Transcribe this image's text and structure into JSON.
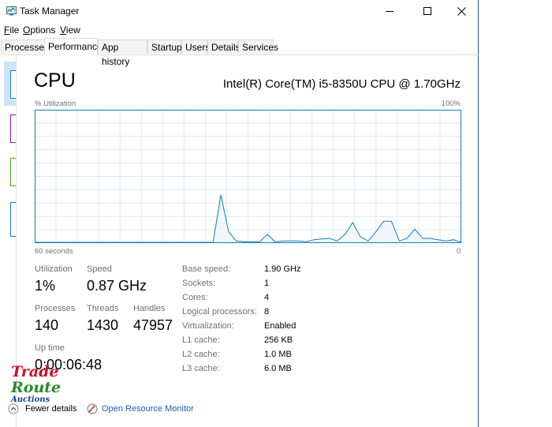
{
  "window": {
    "title": "Task Manager"
  },
  "menu": [
    {
      "label": "File",
      "key": "F",
      "rest": "ile"
    },
    {
      "label": "Options",
      "key": "O",
      "rest": "ptions"
    },
    {
      "label": "View",
      "key": "V",
      "rest": "iew"
    }
  ],
  "tabs": [
    "Processes",
    "Performance",
    "App history",
    "Startup",
    "Users",
    "Details",
    "Services"
  ],
  "active_tab": "Performance",
  "cpu": {
    "title": "CPU",
    "model": "Intel(R) Core(TM) i5-8350U CPU @ 1.70GHz",
    "graph_label": "% Utilization",
    "graph_max": "100%",
    "time_left": "60 seconds",
    "time_right": "0"
  },
  "chart_data": {
    "type": "area",
    "x": [
      60,
      59,
      58,
      57,
      56,
      55,
      54,
      53,
      52,
      51,
      50,
      49,
      48,
      47,
      46,
      45,
      44,
      43,
      42,
      41,
      40,
      39,
      38,
      37,
      36,
      35,
      34,
      33,
      32,
      31,
      30,
      29,
      28,
      27,
      26,
      25,
      24,
      23,
      22,
      21,
      20,
      19,
      18,
      17,
      16,
      15,
      14,
      13,
      12,
      11,
      10,
      9,
      8,
      7,
      6,
      5,
      4,
      3,
      2,
      1,
      0
    ],
    "values": [
      0,
      0,
      0,
      0,
      0,
      0,
      0,
      0,
      0,
      0,
      0,
      0,
      0,
      0,
      0,
      0,
      0,
      0,
      0,
      0,
      0,
      0,
      0,
      0,
      36,
      8,
      1,
      0.5,
      0.5,
      0.5,
      6,
      0.5,
      1,
      1,
      1,
      0.5,
      2,
      2.5,
      3,
      1,
      6,
      15,
      4,
      1,
      8,
      16,
      16,
      1,
      3,
      10,
      3,
      3,
      2,
      1,
      2,
      0
    ],
    "ylim": [
      0,
      100
    ],
    "xlim": [
      60,
      0
    ],
    "grid": true,
    "color": "#117dbb",
    "fill": "#f1f6fa"
  },
  "stats": {
    "utilization_label": "Utilization",
    "utilization": "1%",
    "speed_label": "Speed",
    "speed": "0.87 GHz",
    "processes_label": "Processes",
    "processes": "140",
    "threads_label": "Threads",
    "threads": "1430",
    "handles_label": "Handles",
    "handles": "47957",
    "uptime_label": "Up time",
    "uptime": "0:00:06:48"
  },
  "specs": [
    {
      "label": "Base speed:",
      "value": "1.90 GHz"
    },
    {
      "label": "Sockets:",
      "value": "1"
    },
    {
      "label": "Cores:",
      "value": "4"
    },
    {
      "label": "Logical processors:",
      "value": "8"
    },
    {
      "label": "Virtualization:",
      "value": "Enabled"
    },
    {
      "label": "L1 cache:",
      "value": "256 KB"
    },
    {
      "label": "L2 cache:",
      "value": "1.0 MB"
    },
    {
      "label": "L3 cache:",
      "value": "6.0 MB"
    }
  ],
  "footer": {
    "fewer_details": "Fewer details",
    "resource_monitor": "Open Resource Monitor"
  },
  "watermark": {
    "line1": "Trade",
    "line2": "Route",
    "line3": "Auctions"
  }
}
